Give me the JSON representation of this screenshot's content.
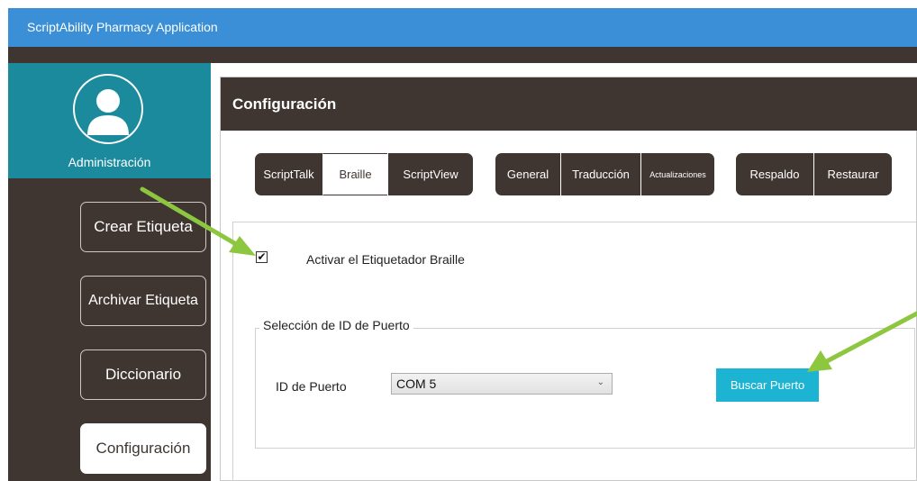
{
  "app": {
    "title": "ScriptAbility Pharmacy Application"
  },
  "sidebar": {
    "user_label": "Administración",
    "items": [
      {
        "label": "Crear Etiqueta"
      },
      {
        "label": "Archivar Etiqueta"
      },
      {
        "label": "Diccionario"
      },
      {
        "label": "Configuración",
        "active": true
      }
    ]
  },
  "panel": {
    "title": "Configuración",
    "tab_groups": [
      {
        "tabs": [
          {
            "label": "ScriptTalk"
          },
          {
            "label": "Braille",
            "selected": true
          },
          {
            "label": "ScriptView"
          }
        ]
      },
      {
        "tabs": [
          {
            "label": "General"
          },
          {
            "label": "Traducción"
          },
          {
            "label": "Actualizaciones"
          }
        ]
      },
      {
        "tabs": [
          {
            "label": "Respaldo"
          },
          {
            "label": "Restaurar"
          }
        ]
      }
    ]
  },
  "braille": {
    "enable_label": "Activar el Etiquetador Braille",
    "enable_checked": true,
    "checkmark": "✔",
    "port_group_title": "Selección de ID de Puerto",
    "port_label": "ID de Puerto",
    "port_value": "COM 5",
    "search_button": "Buscar Puerto"
  },
  "colors": {
    "titlebar": "#3a8fd6",
    "dark": "#3f3631",
    "teal": "#1a8a9c",
    "button_accent": "#1db4d4",
    "annotation_arrow": "#8dc63f"
  },
  "icons": {
    "avatar": "user-icon",
    "dropdown": "chevron-down-icon"
  }
}
